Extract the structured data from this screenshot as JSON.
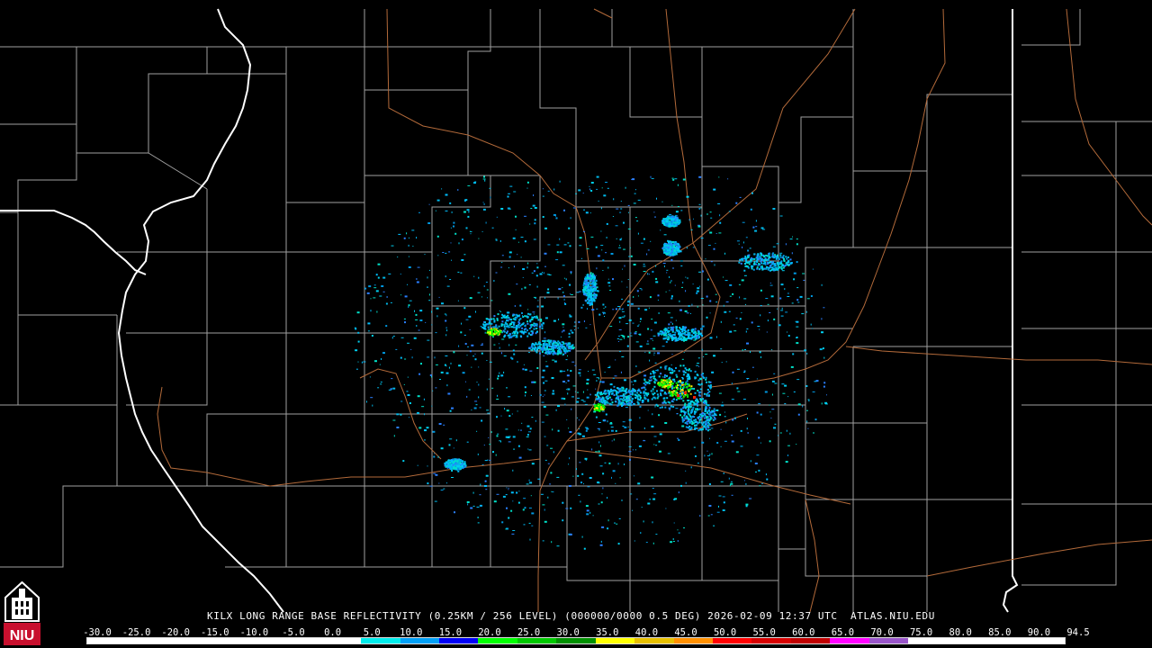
{
  "caption": "KILX LONG RANGE BASE REFLECTIVITY (0.25KM / 256 LEVEL) (000000/0000 0.5 DEG) 2026-02-09 12:37 UTC  ATLAS.NIU.EDU",
  "logo": {
    "text": "NIU",
    "icon": "niu-logo-icon",
    "color": "#c8102e"
  },
  "scale": {
    "labels": [
      "-30.0",
      "-25.0",
      "-20.0",
      "-15.0",
      "-10.0",
      "-5.0",
      "0.0",
      "5.0",
      "10.0",
      "15.0",
      "20.0",
      "25.0",
      "30.0",
      "35.0",
      "40.0",
      "45.0",
      "50.0",
      "55.0",
      "60.0",
      "65.0",
      "70.0",
      "75.0",
      "80.0",
      "85.0",
      "90.0",
      "94.5"
    ],
    "colors": [
      "#ffffff",
      "#ffffff",
      "#ffffff",
      "#ffffff",
      "#ffffff",
      "#ffffff",
      "#ffffff",
      "#00ecec",
      "#01a0f6",
      "#0000f6",
      "#00ff00",
      "#00c800",
      "#009000",
      "#ffff00",
      "#e7c000",
      "#ff9000",
      "#ff0000",
      "#d60000",
      "#c00000",
      "#ff00ff",
      "#9955c9",
      "#ffffff",
      "#ffffff",
      "#ffffff",
      "#ffffff"
    ]
  },
  "map_colors": {
    "county": "#a0a0a0",
    "state": "#ffffff",
    "highway": "#b36a3a",
    "background": "#000000"
  },
  "radar": {
    "site": "KILX"
  }
}
